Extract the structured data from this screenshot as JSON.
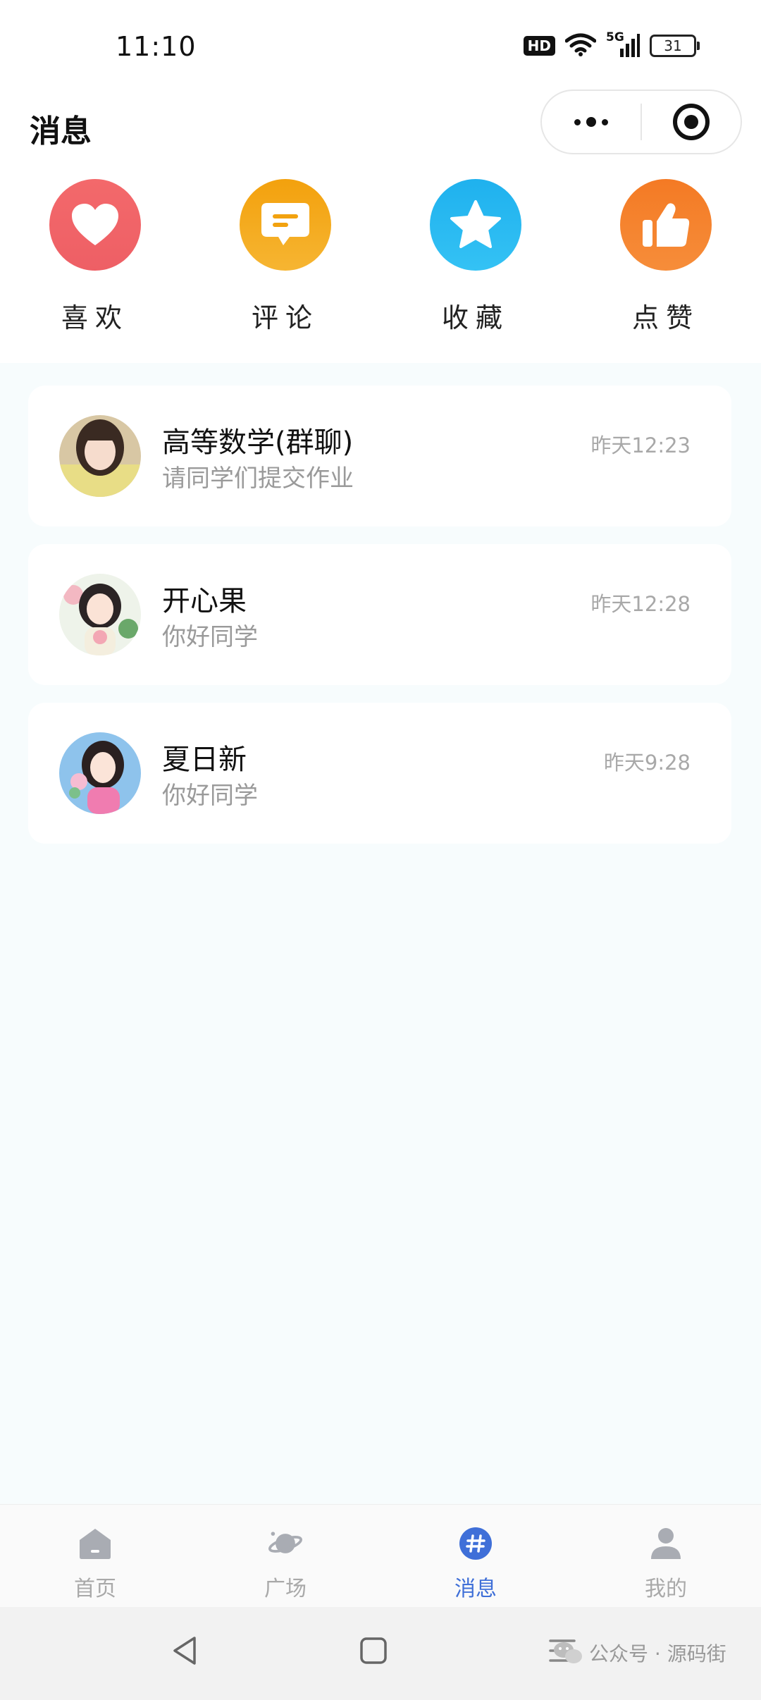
{
  "status_bar": {
    "time": "11:10",
    "hd": "HD",
    "network": "5G",
    "battery": "31"
  },
  "header": {
    "title": "消息"
  },
  "shortcuts": [
    {
      "label": "喜欢",
      "icon": "heart-icon",
      "color": "#ef6266"
    },
    {
      "label": "评论",
      "icon": "comment-icon",
      "color": "#f2a20f"
    },
    {
      "label": "收藏",
      "icon": "star-icon",
      "color": "#24b6ef"
    },
    {
      "label": "点赞",
      "icon": "thumbs-up-icon",
      "color": "#f4802b"
    }
  ],
  "messages": [
    {
      "name": "高等数学(群聊)",
      "preview": "请同学们提交作业",
      "time": "昨天12:23"
    },
    {
      "name": "开心果",
      "preview": "你好同学",
      "time": "昨天12:28"
    },
    {
      "name": "夏日新",
      "preview": "你好同学",
      "time": "昨天9:28"
    }
  ],
  "tabbar": [
    {
      "label": "首页",
      "icon": "home-icon",
      "active": false
    },
    {
      "label": "广场",
      "icon": "planet-icon",
      "active": false
    },
    {
      "label": "消息",
      "icon": "hashtag-icon",
      "active": true
    },
    {
      "label": "我的",
      "icon": "user-icon",
      "active": false
    }
  ],
  "watermark": "公众号 · 源码街",
  "colors": {
    "accent": "#3f6fd8",
    "background": "#f7fcfd"
  }
}
